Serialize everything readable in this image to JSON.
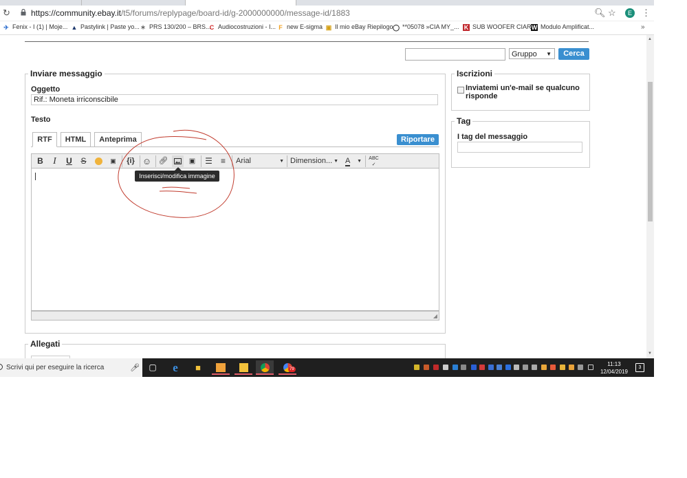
{
  "browser": {
    "url_host": "https://community.ebay.it",
    "url_path": "/t5/forums/replypage/board-id/g-2000000000/message-id/1883",
    "avatar_letter": "E",
    "bookmarks": [
      {
        "label": "Fenix - I (1) | Moje...",
        "icon_color": "#2e6fcf"
      },
      {
        "label": "Pastylink | Paste yo...",
        "icon_color": "#1f3a6e"
      },
      {
        "label": "PRS 130/200 – BRS...",
        "icon_color": "#666666"
      },
      {
        "label": "Audiocostruzioni - I...",
        "icon_color": "#d22b2b"
      },
      {
        "label": "new E-sigma",
        "icon_color": "#f0a020"
      },
      {
        "label": "Il mio eBay Riepilogo",
        "icon_color": "#d4a017"
      },
      {
        "label": "**05078 »CIA MY_...",
        "icon_color": "#222222"
      },
      {
        "label": "SUB WOOFER CIAR...",
        "icon_color": "#c0282d"
      },
      {
        "label": "Modulo Amplificat...",
        "icon_color": "#111111"
      }
    ],
    "bookmarks_more": "»"
  },
  "search": {
    "input_value": "",
    "scope_value": "Gruppo",
    "button_label": "Cerca"
  },
  "message": {
    "legend": "Inviare messaggio",
    "subject_label": "Oggetto",
    "subject_value": "Rif.: Moneta irriconscibile",
    "body_label": "Testo",
    "tabs": [
      "RTF",
      "HTML",
      "Anteprima"
    ],
    "quote_button": "Riportare",
    "toolbar": {
      "bold": "B",
      "italic": "I",
      "underline": "U",
      "strike": "S",
      "braces": "{i}",
      "font": "Arial",
      "size": "Dimension...",
      "color": "A",
      "spell": "ABC"
    },
    "tooltip": "Inserisci/modifica immagine"
  },
  "attachments": {
    "legend": "Allegati"
  },
  "subscriptions": {
    "legend": "Iscrizioni",
    "checkbox_label": "Inviatemi un'e-mail se qualcuno risponde",
    "checked": false
  },
  "tags": {
    "legend": "Tag",
    "field_label": "I tag del messaggio",
    "field_value": ""
  },
  "taskbar": {
    "search_placeholder": "Scrivi qui per eseguire la ricerca",
    "time": "11:13",
    "date": "12/04/2019",
    "notifications": "3",
    "chrome_badge": "79"
  }
}
